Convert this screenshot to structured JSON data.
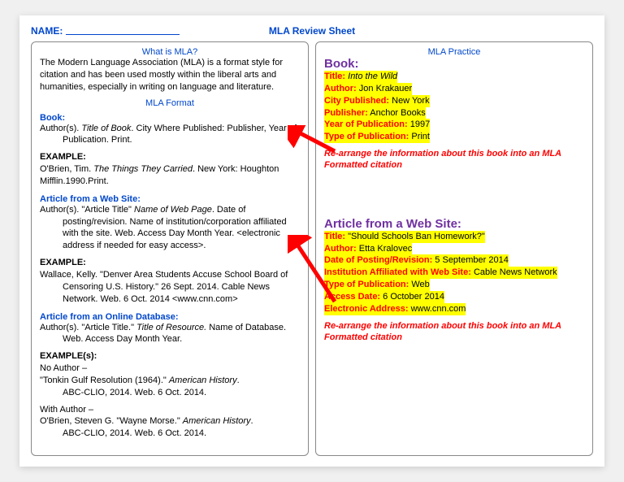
{
  "header": {
    "name_label": "NAME:",
    "title": "MLA Review Sheet"
  },
  "left": {
    "h1": "What is MLA?",
    "intro": "The Modern Language Association (MLA) is a format style for citation and has been used mostly within the liberal arts and humanities, especially in writing on language and literature.",
    "format_h": "MLA Format",
    "book_h": "Book:",
    "book_tpl_1": "Author(s). ",
    "book_tpl_italic": "Title of Book",
    "book_tpl_2": ". City Where Published: Publisher, Year of",
    "book_tpl_indent": "Publication. Print.",
    "ex_h": "EXAMPLE:",
    "ex_book_1": "O'Brien, Tim. ",
    "ex_book_italic": "The Things They Carried",
    "ex_book_2": ". New York: Houghton Mifflin.1990.Print.",
    "web_h": "Article from a Web Site:",
    "web_tpl_1": "Author(s). \"Article Title\" ",
    "web_tpl_italic": "Name of Web Page",
    "web_tpl_2": ". Date of",
    "web_tpl_indent1": "posting/revision. Name of institution/corporation affiliated with the site. Web. Access Day Month Year. <electronic address if needed for easy access>.",
    "ex_web_1": "Wallace, Kelly. \"Denver Area Students Accuse School Board of",
    "ex_web_indent": "Censoring U.S. History.\" 26 Sept. 2014. Cable News Network. Web. 6 Oct. 2014 <www.cnn.com>",
    "db_h": "Article from an Online Database:",
    "db_tpl_1": "Author(s). \"Article Title.\" ",
    "db_tpl_italic": "Title of Resource.",
    "db_tpl_2": " Name of Database.",
    "db_tpl_indent": "Web. Access Day Month Year.",
    "exs_h": "EXAMPLE(s):",
    "noauth_l": "No Author –",
    "noauth_1": "\"Tonkin Gulf Resolution (1964).\" ",
    "noauth_italic": "American History",
    "noauth_2": ".",
    "noauth_indent": "ABC-CLIO, 2014. Web. 6 Oct. 2014.",
    "withauth_l": "With Author –",
    "withauth_1": "O'Brien, Steven G. \"Wayne Morse.\" ",
    "withauth_italic": "American History",
    "withauth_2": ".",
    "withauth_indent": "ABC-CLIO, 2014. Web. 6 Oct. 2014."
  },
  "right": {
    "h1": "MLA Practice",
    "book_h": "Book:",
    "book_fields": {
      "title_l": "Title:",
      "title_v": " Into the Wild",
      "author_l": "Author:",
      "author_v": " Jon Krakauer",
      "city_l": "City Published:",
      "city_v": " New York",
      "pub_l": "Publisher:",
      "pub_v": " Anchor Books",
      "year_l": "Year of Publication:",
      "year_v": " 1997",
      "type_l": "Type of Publication:",
      "type_v": " Print"
    },
    "instruction": "Re-arrange the information about this book into an MLA Formatted citation",
    "web_h": "Article from a Web Site:",
    "web_fields": {
      "title_l": "Title:",
      "title_v": " \"Should Schools Ban Homework?\"",
      "author_l": "Author:",
      "author_v": " Etta Kralovec",
      "date_l": "Date of Posting/Revision:",
      "date_v": " 5 September 2014",
      "inst_l": "Institution Affiliated with Web Site:",
      "inst_v": " Cable News Network",
      "type_l": "Type of Publication:",
      "type_v": " Web",
      "access_l": "Access Date:",
      "access_v": " 6 October 2014",
      "addr_l": "Electronic Address:",
      "addr_v": " www.cnn.com"
    }
  }
}
